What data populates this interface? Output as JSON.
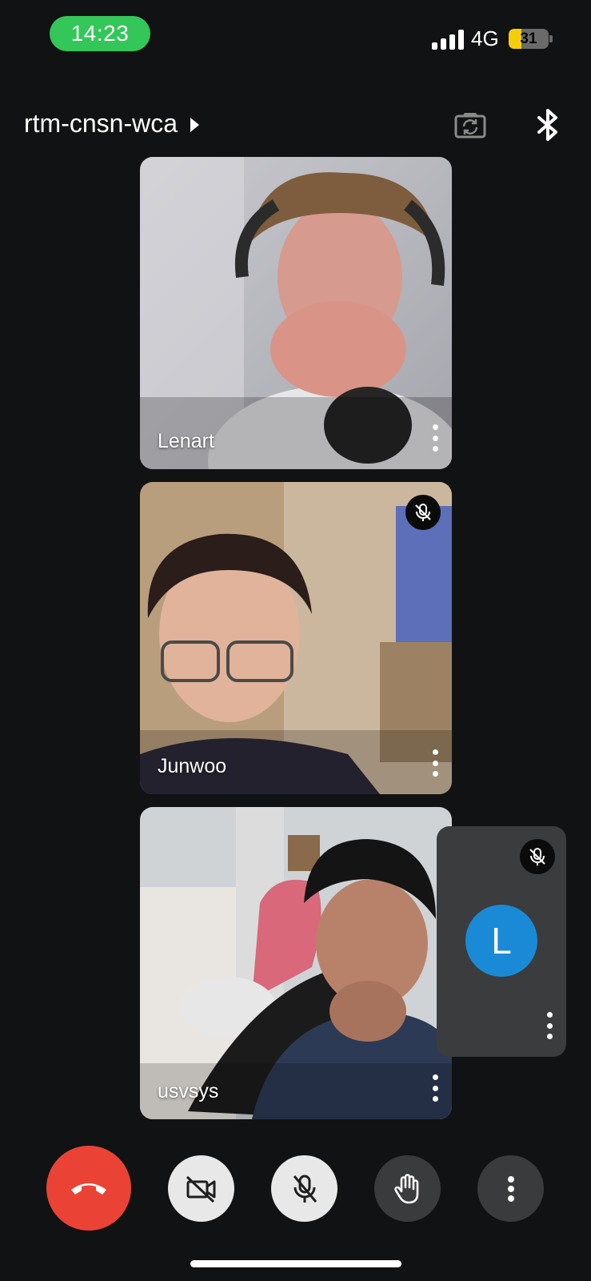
{
  "status_bar": {
    "time": "14:23",
    "network": "4G",
    "battery": "31",
    "battery_level": 0.31
  },
  "header": {
    "meeting_code": "rtm-cnsn-wca",
    "flip_camera_icon": "camera-flip-icon",
    "bluetooth_icon": "bluetooth-icon"
  },
  "participants": [
    {
      "name": "Lenart",
      "muted": false
    },
    {
      "name": "Junwoo",
      "muted": true
    },
    {
      "name": "usvsys",
      "muted": false
    }
  ],
  "self_view": {
    "initial": "L",
    "muted": true,
    "avatar_color": "#1a8ad6"
  },
  "controls": {
    "end_call": "end-call-icon",
    "camera": "camera-off-icon",
    "microphone": "mic-off-icon",
    "raise_hand": "hand-icon",
    "more": "more-vert-icon"
  },
  "colors": {
    "background": "#111213",
    "end_call": "#ea4335",
    "status_pill": "#33c759",
    "battery_fill": "#f6cd0a"
  }
}
